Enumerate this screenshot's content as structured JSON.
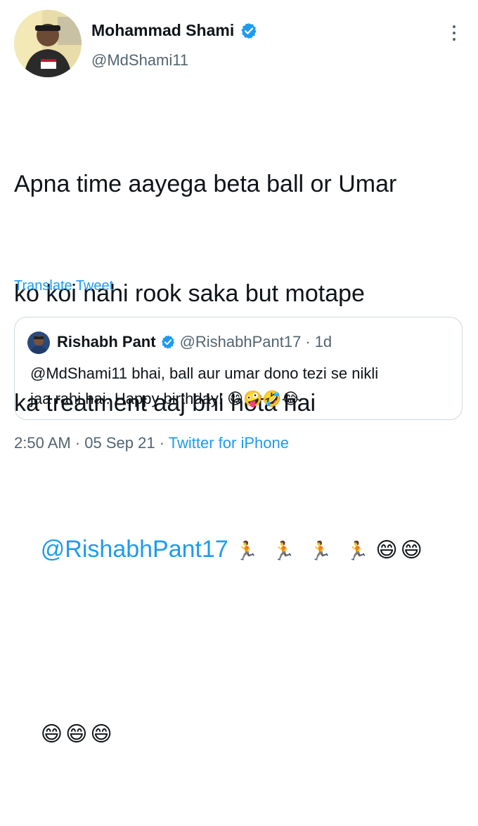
{
  "author": {
    "display_name": "Mohammad Shami",
    "handle": "@MdShami11"
  },
  "tweet": {
    "line1": "Apna time aayega beta ball or Umar",
    "line2": "ko koi nahi rook saka but motape",
    "line3": "ka treatment aaj bhi hota hai",
    "mention": "@RishabhPant17",
    "runner_emoji": "🏃",
    "grin_emoji": "😄",
    "translate_label": "Translate Tweet"
  },
  "quote": {
    "display_name": "Rishabh Pant",
    "handle": "@RishabhPant17",
    "separator": "·",
    "age": "1d",
    "mention": "@MdShami11",
    "text_rest": " bhai, ball aur umar dono tezi se nikli",
    "text_line2": "jaa rahi hai. Happy birthday!",
    "emojis": "😋🤪🤣😂"
  },
  "meta": {
    "time": "2:50 AM",
    "sep1": "·",
    "date": "05 Sep 21",
    "sep2": "·",
    "source": "Twitter for iPhone"
  },
  "icons": {
    "verified": "verified-badge-icon",
    "more": "more-options-icon"
  },
  "colors": {
    "link": "#1d9bf0",
    "secondary": "#536471",
    "text": "#0f1419",
    "border": "#cfd9de"
  }
}
